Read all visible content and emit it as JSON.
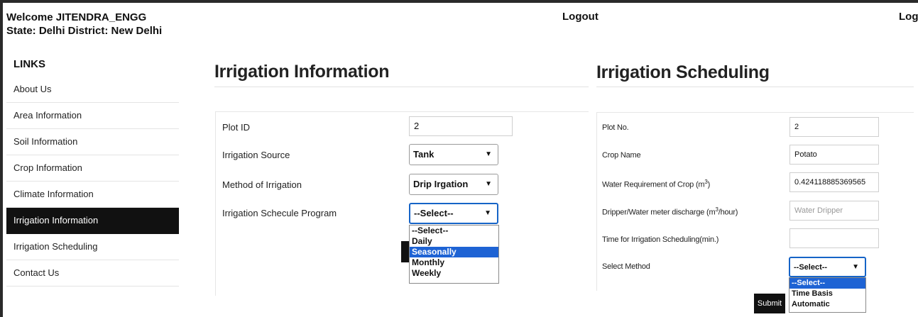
{
  "header": {
    "welcome": "Welcome JITENDRA_ENGG",
    "location": "State: Delhi District: New Delhi",
    "logout_label": "Logout"
  },
  "sidebar": {
    "title": "LINKS",
    "items": [
      {
        "label": "About Us"
      },
      {
        "label": "Area Information"
      },
      {
        "label": "Soil Information"
      },
      {
        "label": "Crop Information"
      },
      {
        "label": "Climate Information"
      },
      {
        "label": "Irrigation Information",
        "active": true
      },
      {
        "label": "Irrigation Scheduling"
      },
      {
        "label": "Contact Us"
      }
    ]
  },
  "irrigation_info": {
    "title": "Irrigation Information",
    "plot_id": {
      "label": "Plot ID",
      "value": "2"
    },
    "source": {
      "label": "Irrigation Source",
      "value": "Tank"
    },
    "method": {
      "label": "Method of Irrigation",
      "value": "Drip Irgation"
    },
    "program": {
      "label": "Irrigation Schecule Program",
      "value": "--Select--",
      "options": [
        "--Select--",
        "Daily",
        "Seasonally",
        "Monthly",
        "Weekly"
      ],
      "highlighted": "Seasonally"
    }
  },
  "irrigation_scheduling": {
    "title": "Irrigation Scheduling",
    "plot_no": {
      "label": "Plot No.",
      "value": "2"
    },
    "crop_name": {
      "label": "Crop Name",
      "value": "Potato"
    },
    "water_req": {
      "label_pre": "Water Requirement of Crop (m",
      "label_sup": "3",
      "label_post": ")",
      "value": "0.424118885369565"
    },
    "dripper": {
      "label_pre": "Dripper/Water meter discharge (m",
      "label_sup": "3",
      "label_post": "/hour)",
      "placeholder": "Water Dripper"
    },
    "time": {
      "label": "Time for Irrigation Scheduling(min.)",
      "value": ""
    },
    "select_method": {
      "label": "Select Method",
      "value": "--Select--",
      "options": [
        "--Select--",
        "Time Basis",
        "Automatic"
      ],
      "highlighted": "--Select--"
    },
    "submit_label": "Submit"
  }
}
